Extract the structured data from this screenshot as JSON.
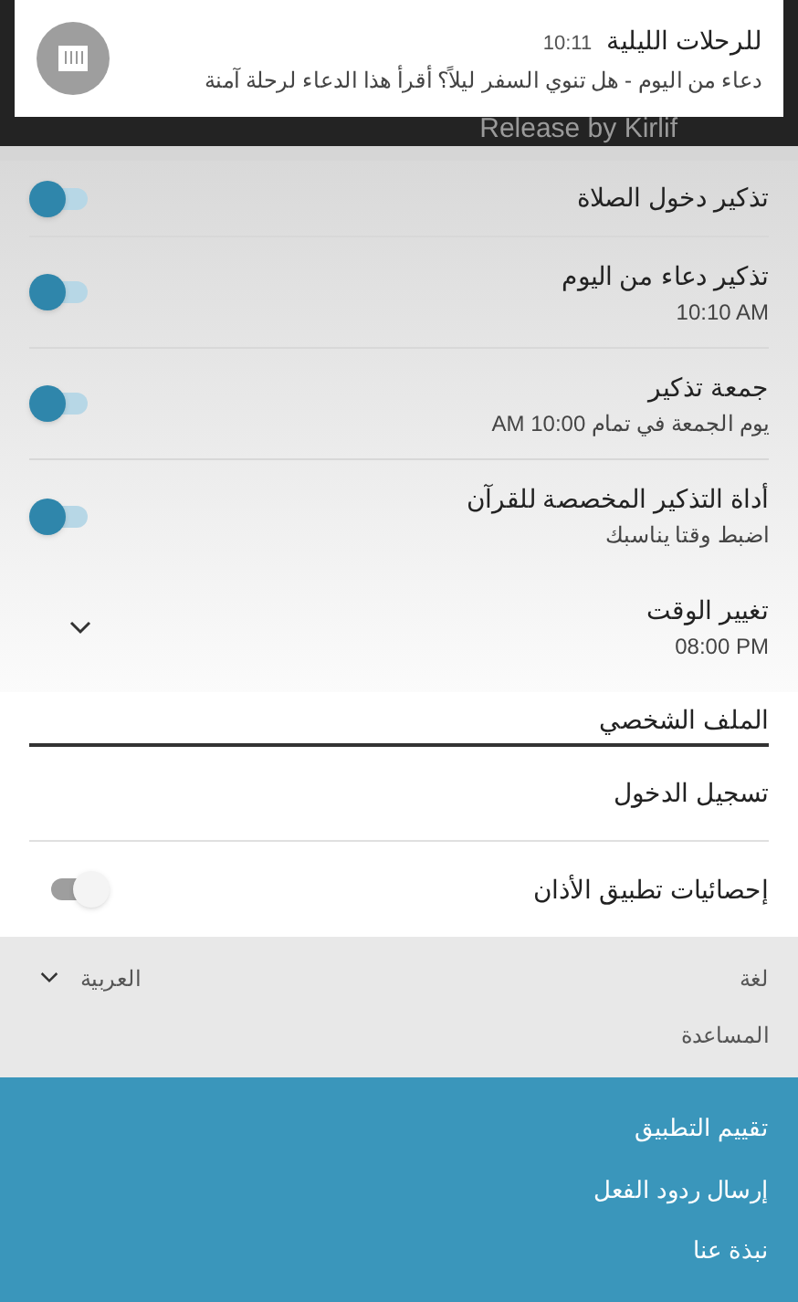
{
  "notification": {
    "time": "10:11",
    "title": "للرحلات الليلية",
    "text": "دعاء من اليوم - هل تنوي السفر ليلاً؟ أقرأ هذا الدعاء لرحلة آمنة"
  },
  "header": {
    "release_text": "Release by Kirlif"
  },
  "settings": [
    {
      "kind": "toggle",
      "title": "تذكير دخول الصلاة",
      "on": true
    },
    {
      "kind": "toggle",
      "title": "تذكير دعاء من اليوم",
      "subtitle": "10:10 AM",
      "on": true
    },
    {
      "kind": "toggle",
      "title": "جمعة تذكير",
      "subtitle": "يوم الجمعة في تمام 10:00 AM",
      "on": true
    },
    {
      "kind": "toggle",
      "title": "أداة التذكير المخصصة للقرآن",
      "subtitle": "اضبط وقتا يناسبك",
      "on": true
    },
    {
      "kind": "dropdown",
      "title": "تغيير الوقت",
      "subtitle": "08:00 PM"
    }
  ],
  "profile": {
    "header": "الملف الشخصي",
    "items": [
      {
        "kind": "link",
        "title": "تسجيل الدخول"
      },
      {
        "kind": "toggle",
        "title": "إحصائيات تطبيق الأذان",
        "on": false
      }
    ]
  },
  "language": {
    "label": "لغة",
    "value": "العربية"
  },
  "help": "المساعدة",
  "footer": [
    "تقييم التطبيق",
    "إرسال ردود الفعل",
    "نبذة عنا"
  ]
}
